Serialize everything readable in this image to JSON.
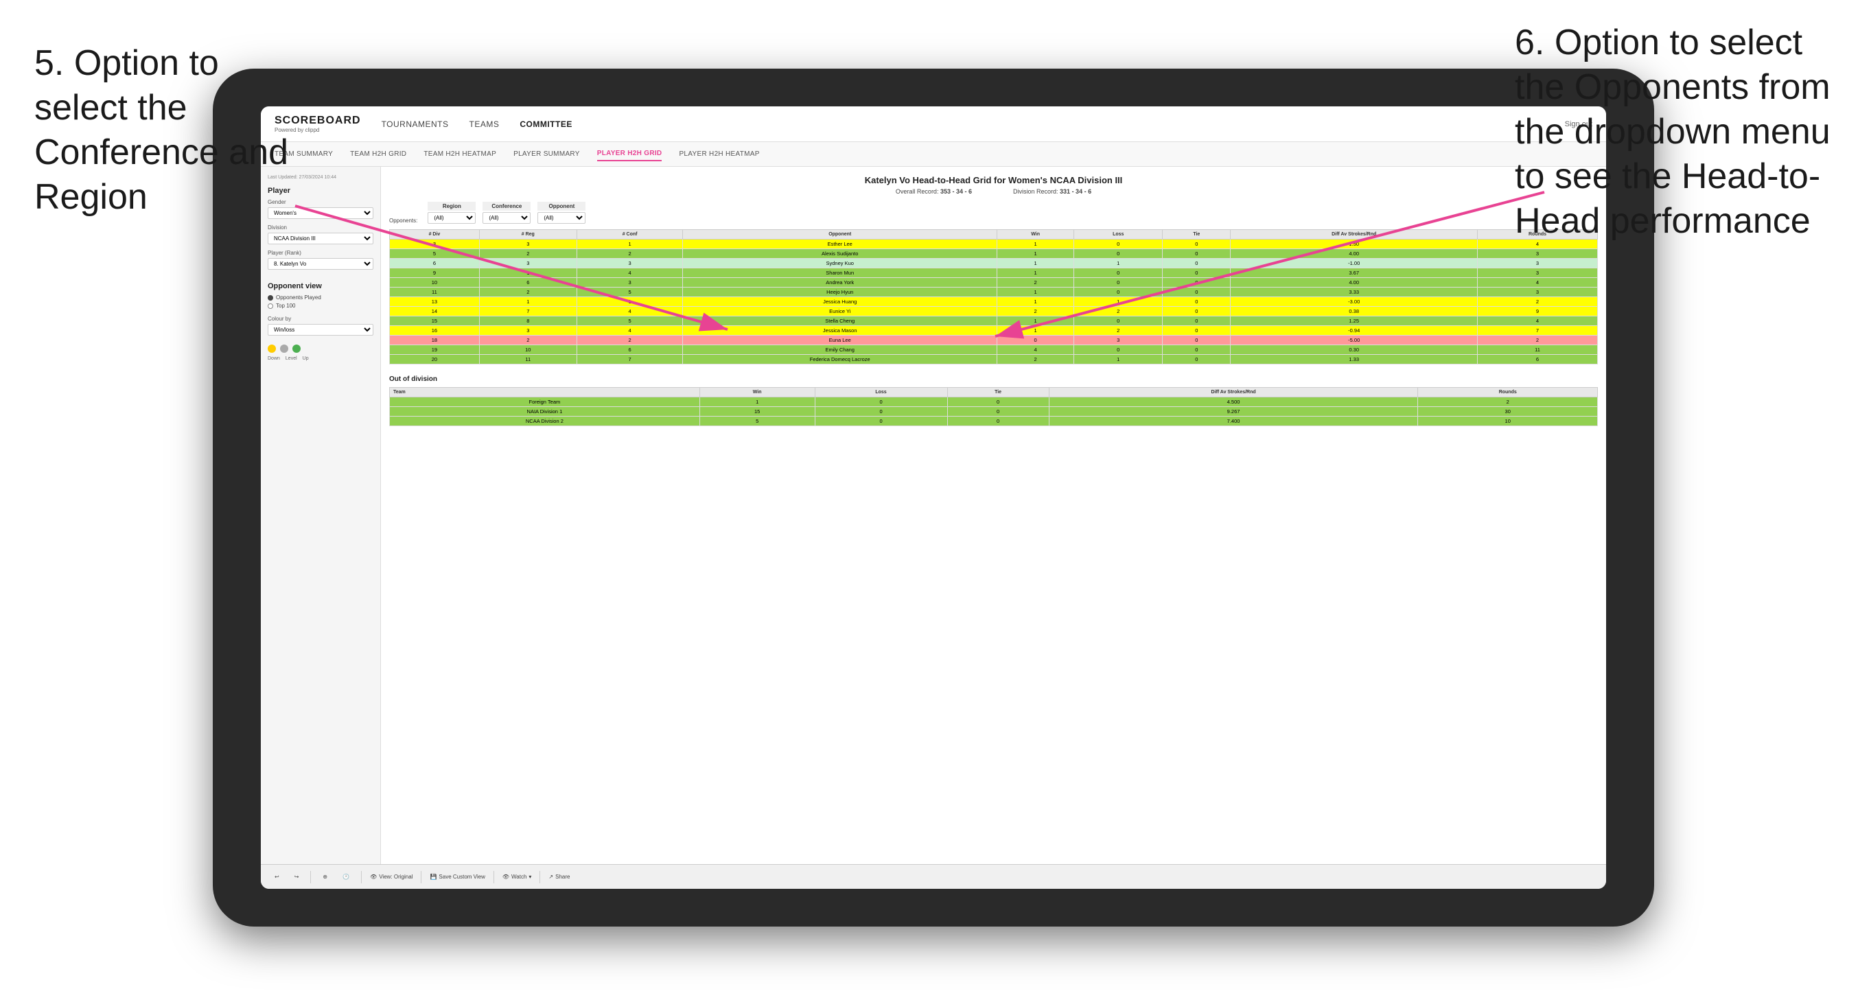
{
  "annotations": {
    "left_title": "5. Option to select the Conference and Region",
    "right_title": "6. Option to select the Opponents from the dropdown menu to see the Head-to-Head performance"
  },
  "nav": {
    "logo": "SCOREBOARD",
    "logo_sub": "Powered by clippd",
    "items": [
      "TOURNAMENTS",
      "TEAMS",
      "COMMITTEE"
    ],
    "sign_out": "Sign out"
  },
  "sub_nav": {
    "items": [
      "TEAM SUMMARY",
      "TEAM H2H GRID",
      "TEAM H2H HEATMAP",
      "PLAYER SUMMARY",
      "PLAYER H2H GRID",
      "PLAYER H2H HEATMAP"
    ],
    "active": "PLAYER H2H GRID"
  },
  "sidebar": {
    "updated": "Last Updated: 27/03/2024 10:44",
    "player_section": "Player",
    "gender_label": "Gender",
    "gender_value": "Women's",
    "division_label": "Division",
    "division_value": "NCAA Division III",
    "player_rank_label": "Player (Rank)",
    "player_rank_value": "8. Katelyn Vo",
    "opponent_view_label": "Opponent view",
    "opponent_played": "Opponents Played",
    "top_100": "Top 100",
    "colour_by_label": "Colour by",
    "colour_value": "Win/loss",
    "legend": [
      "Down",
      "Level",
      "Up"
    ]
  },
  "main": {
    "title": "Katelyn Vo Head-to-Head Grid for Women's NCAA Division III",
    "overall_record_label": "Overall Record:",
    "overall_record": "353 - 34 - 6",
    "division_record_label": "Division Record:",
    "division_record": "331 - 34 - 6",
    "region_label": "Region",
    "conference_label": "Conference",
    "opponent_label": "Opponent",
    "opponents_label": "Opponents:",
    "all_option": "(All)",
    "table_headers": [
      "# Div",
      "# Reg",
      "# Conf",
      "Opponent",
      "Win",
      "Loss",
      "Tie",
      "Diff Av Strokes/Rnd",
      "Rounds"
    ],
    "rows": [
      {
        "div": 3,
        "reg": 3,
        "conf": 1,
        "opponent": "Esther Lee",
        "win": 1,
        "loss": 0,
        "tie": 0,
        "diff": "1.50",
        "rounds": 4,
        "color": "yellow"
      },
      {
        "div": 5,
        "reg": 2,
        "conf": 2,
        "opponent": "Alexis Sudijanto",
        "win": 1,
        "loss": 0,
        "tie": 0,
        "diff": "4.00",
        "rounds": 3,
        "color": "green"
      },
      {
        "div": 6,
        "reg": 3,
        "conf": 3,
        "opponent": "Sydney Kuo",
        "win": 1,
        "loss": 1,
        "tie": 0,
        "diff": "-1.00",
        "rounds": 3,
        "color": "light-green"
      },
      {
        "div": 9,
        "reg": 1,
        "conf": 4,
        "opponent": "Sharon Mun",
        "win": 1,
        "loss": 0,
        "tie": 0,
        "diff": "3.67",
        "rounds": 3,
        "color": "green"
      },
      {
        "div": 10,
        "reg": 6,
        "conf": 3,
        "opponent": "Andrea York",
        "win": 2,
        "loss": 0,
        "tie": 0,
        "diff": "4.00",
        "rounds": 4,
        "color": "green"
      },
      {
        "div": 11,
        "reg": 2,
        "conf": 5,
        "opponent": "Heejo Hyun",
        "win": 1,
        "loss": 0,
        "tie": 0,
        "diff": "3.33",
        "rounds": 3,
        "color": "green"
      },
      {
        "div": 13,
        "reg": 1,
        "conf": 1,
        "opponent": "Jessica Huang",
        "win": 1,
        "loss": 1,
        "tie": 0,
        "diff": "-3.00",
        "rounds": 2,
        "color": "yellow"
      },
      {
        "div": 14,
        "reg": 7,
        "conf": 4,
        "opponent": "Eunice Yi",
        "win": 2,
        "loss": 2,
        "tie": 0,
        "diff": "0.38",
        "rounds": 9,
        "color": "yellow"
      },
      {
        "div": 15,
        "reg": 8,
        "conf": 5,
        "opponent": "Stella Cheng",
        "win": 1,
        "loss": 0,
        "tie": 0,
        "diff": "1.25",
        "rounds": 4,
        "color": "green"
      },
      {
        "div": 16,
        "reg": 3,
        "conf": 4,
        "opponent": "Jessica Mason",
        "win": 1,
        "loss": 2,
        "tie": 0,
        "diff": "-0.94",
        "rounds": 7,
        "color": "yellow"
      },
      {
        "div": 18,
        "reg": 2,
        "conf": 2,
        "opponent": "Euna Lee",
        "win": 0,
        "loss": 3,
        "tie": 0,
        "diff": "-5.00",
        "rounds": 2,
        "color": "red"
      },
      {
        "div": 19,
        "reg": 10,
        "conf": 6,
        "opponent": "Emily Chang",
        "win": 4,
        "loss": 0,
        "tie": 0,
        "diff": "0.30",
        "rounds": 11,
        "color": "green"
      },
      {
        "div": 20,
        "reg": 11,
        "conf": 7,
        "opponent": "Federica Domecq Lacroze",
        "win": 2,
        "loss": 1,
        "tie": 0,
        "diff": "1.33",
        "rounds": 6,
        "color": "green"
      }
    ],
    "out_of_division_title": "Out of division",
    "out_rows": [
      {
        "name": "Foreign Team",
        "win": 1,
        "loss": 0,
        "tie": 0,
        "diff": "4.500",
        "rounds": 2,
        "color": "green"
      },
      {
        "name": "NAIA Division 1",
        "win": 15,
        "loss": 0,
        "tie": 0,
        "diff": "9.267",
        "rounds": 30,
        "color": "green"
      },
      {
        "name": "NCAA Division 2",
        "win": 5,
        "loss": 0,
        "tie": 0,
        "diff": "7.400",
        "rounds": 10,
        "color": "green"
      }
    ]
  },
  "toolbar": {
    "view_original": "View: Original",
    "save_custom": "Save Custom View",
    "watch": "Watch",
    "share": "Share"
  }
}
